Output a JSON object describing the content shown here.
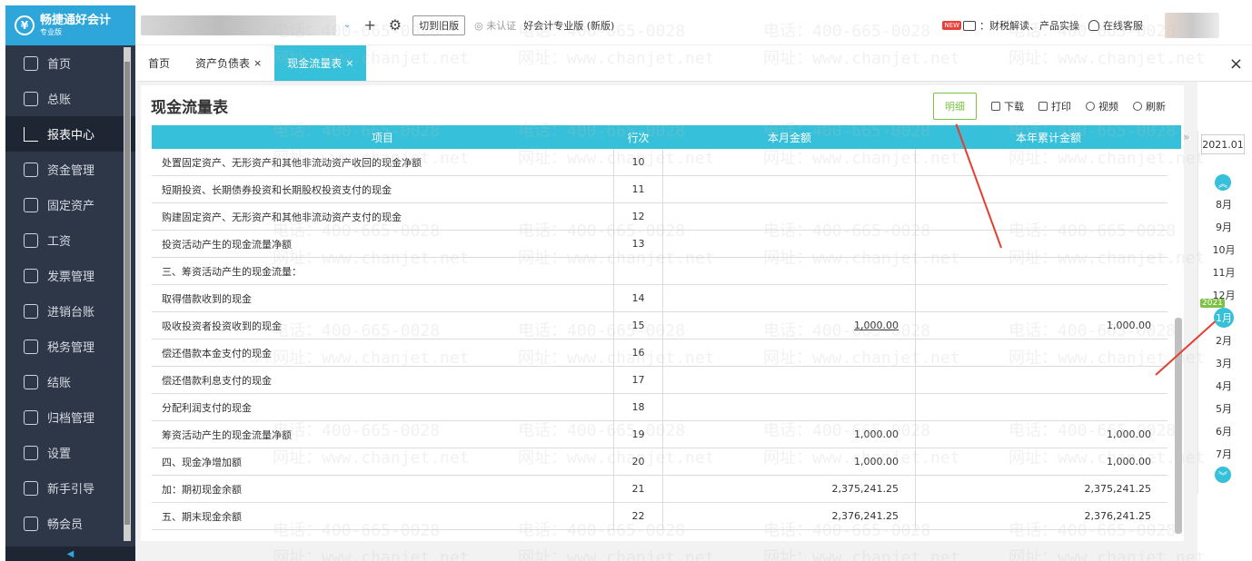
{
  "app": {
    "title": "畅捷通好会计",
    "edition_tag": "专业版",
    "logo_glyph": "¥"
  },
  "sidebar": {
    "items": [
      {
        "label": "首页",
        "icon": "home-icon"
      },
      {
        "label": "总账",
        "icon": "ledger-icon"
      },
      {
        "label": "报表中心",
        "icon": "chart-icon",
        "active": true
      },
      {
        "label": "资金管理",
        "icon": "money-bag-icon"
      },
      {
        "label": "固定资产",
        "icon": "asset-icon"
      },
      {
        "label": "工资",
        "icon": "salary-icon"
      },
      {
        "label": "发票管理",
        "icon": "invoice-icon"
      },
      {
        "label": "进销台账",
        "icon": "inventory-icon"
      },
      {
        "label": "税务管理",
        "icon": "tax-icon"
      },
      {
        "label": "结账",
        "icon": "checkout-icon"
      },
      {
        "label": "归档管理",
        "icon": "archive-icon"
      },
      {
        "label": "设置",
        "icon": "gear-icon"
      },
      {
        "label": "新手引导",
        "icon": "guide-icon"
      },
      {
        "label": "畅会员",
        "icon": "member-icon"
      }
    ],
    "collapse_glyph": "◀"
  },
  "topbar": {
    "dropdown_glyph": "⌄",
    "plus_glyph": "+",
    "gear_glyph": "⚙",
    "switch_old_label": "切到旧版",
    "uncertified_label": "未认证",
    "edition_label": "好会计专业版 (新版)",
    "new_badge": "NEW",
    "finance_link": "：财税解读、产品实操",
    "support_label": "在线客服"
  },
  "tabs": [
    {
      "label": "首页",
      "closable": false,
      "active": false
    },
    {
      "label": "资产负债表",
      "closable": true,
      "active": false
    },
    {
      "label": "现金流量表",
      "closable": true,
      "active": true
    }
  ],
  "tabs_close_glyph": "×",
  "report": {
    "title": "现金流量表",
    "toolbar": {
      "detail": "明细",
      "download": "下载",
      "print": "打印",
      "video": "视频",
      "refresh": "刷新"
    },
    "columns": [
      "项目",
      "行次",
      "本月金额",
      "本年累计金额"
    ],
    "rows": [
      {
        "item": "处置固定资产、无形资产和其他非流动资产收回的现金净额",
        "line": "10",
        "month": "",
        "year": ""
      },
      {
        "item": "短期投资、长期债券投资和长期股权投资支付的现金",
        "line": "11",
        "month": "",
        "year": ""
      },
      {
        "item": "购建固定资产、无形资产和其他非流动资产支付的现金",
        "line": "12",
        "month": "",
        "year": ""
      },
      {
        "item": "投资活动产生的现金流量净额",
        "line": "13",
        "month": "",
        "year": ""
      },
      {
        "item": "三、筹资活动产生的现金流量：",
        "line": "",
        "month": "",
        "year": ""
      },
      {
        "item": "取得借款收到的现金",
        "line": "14",
        "month": "",
        "year": ""
      },
      {
        "item": "吸收投资者投资收到的现金",
        "line": "15",
        "month": "1,000.00",
        "year": "1,000.00",
        "month_link": true
      },
      {
        "item": "偿还借款本金支付的现金",
        "line": "16",
        "month": "",
        "year": ""
      },
      {
        "item": "偿还借款利息支付的现金",
        "line": "17",
        "month": "",
        "year": ""
      },
      {
        "item": "分配利润支付的现金",
        "line": "18",
        "month": "",
        "year": ""
      },
      {
        "item": "筹资活动产生的现金流量净额",
        "line": "19",
        "month": "1,000.00",
        "year": "1,000.00"
      },
      {
        "item": "四、现金净增加额",
        "line": "20",
        "month": "1,000.00",
        "year": "1,000.00"
      },
      {
        "item": "加：期初现金余额",
        "line": "21",
        "month": "2,375,241.25",
        "year": "2,375,241.25"
      },
      {
        "item": "五、期末现金余额",
        "line": "22",
        "month": "2,376,241.25",
        "year": "2,376,241.25"
      }
    ]
  },
  "period": {
    "expand_glyph": "»",
    "year_period": "2021.01",
    "up_glyph": "︽",
    "down_glyph": "︾",
    "year_tag": "2021",
    "months": [
      "8月",
      "9月",
      "10月",
      "11月",
      "12月",
      "1月",
      "2月",
      "3月",
      "4月",
      "5月",
      "6月",
      "7月"
    ],
    "active_month": "1月"
  },
  "watermark": {
    "phone": "电话：400-665-0028",
    "site": "网址：www.chanjet.net"
  },
  "colors": {
    "accent": "#36c0d9",
    "sidebar_bg": "#2e3748",
    "logo_bg": "#2ea6d9",
    "detail_green": "#7dc244",
    "annotation_red": "#e53d30"
  }
}
